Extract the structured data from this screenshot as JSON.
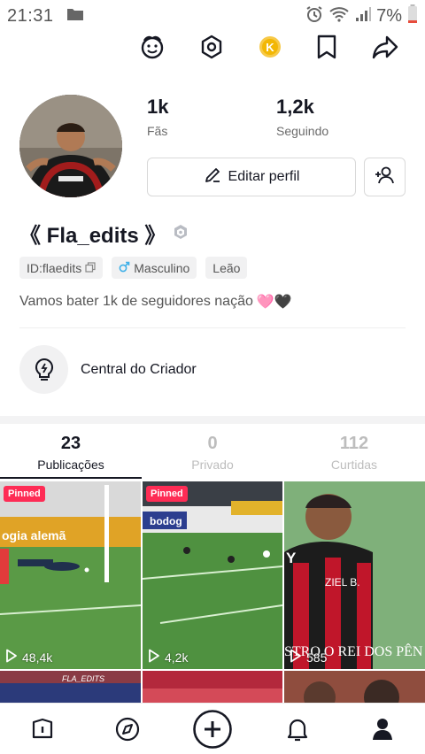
{
  "status_bar": {
    "time": "21:31",
    "battery": "7%"
  },
  "top_icons": [
    "sticker-icon",
    "hexagon-settings-icon",
    "coin-icon",
    "bookmark-icon",
    "share-icon"
  ],
  "profile": {
    "followers_count": "1k",
    "followers_label": "Fãs",
    "following_count": "1,2k",
    "following_label": "Seguindo",
    "edit_button_label": "Editar perfil",
    "username": "《 Fla_edits 》",
    "tags": [
      "ID:flaedits",
      "Masculino",
      "Leão"
    ],
    "bio": "Vamos bater 1k de seguidores nação",
    "bio_emojis": "🩷🖤",
    "creator_center_label": "Central do Criador"
  },
  "tabs": [
    {
      "count": "23",
      "label": "Publicações",
      "active": true
    },
    {
      "count": "0",
      "label": "Privado",
      "active": false
    },
    {
      "count": "112",
      "label": "Curtidas",
      "active": false
    }
  ],
  "videos": [
    {
      "pinned_label": "Pinned",
      "views": "48,4k",
      "banner": "ogia alemã"
    },
    {
      "pinned_label": "Pinned",
      "views": "4,2k",
      "banner": "bodog"
    },
    {
      "pinned_label": "",
      "views": "585",
      "overlay_text": "STRO O REI DOS PÊN",
      "jersey_text": "ZIEL B."
    }
  ],
  "second_row_overlay": "FLA_EDITS",
  "bottom_nav": [
    "home-icon",
    "discover-icon",
    "create-icon",
    "notifications-icon",
    "profile-icon"
  ],
  "colors": {
    "accent": "#fe2c55",
    "text": "#161823",
    "muted": "#6b6b6b"
  }
}
